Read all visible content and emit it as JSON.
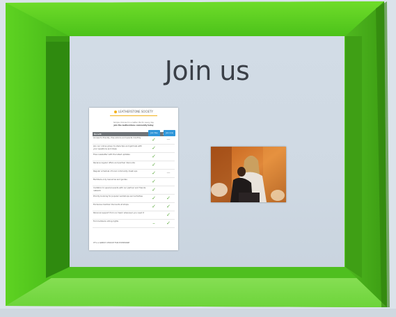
{
  "slide": {
    "title": "Join us"
  },
  "document": {
    "brand": "LEATHERSTONE SOCIETY",
    "intro_line": "Simple choices for a better life for every day",
    "intro_bold": "Join the leatherstone community today",
    "columns": [
      "Benefit",
      "Free",
      "Member"
    ],
    "rows": [
      {
        "text": "Access to friendly, free advice and events monthly",
        "free": "✓",
        "member": "—"
      },
      {
        "text": "Join our online group to share tips and get help with your questions and ideas",
        "free": "✓",
        "member": ""
      },
      {
        "text": "Free newsletter with the latest updates",
        "free": "✓",
        "member": ""
      },
      {
        "text": "Receive regular offers and partner discounts",
        "free": "✓",
        "member": ""
      },
      {
        "text": "Regular schedule of local community meet ups",
        "free": "✓",
        "member": "—"
      },
      {
        "text": "Members-only resources and guides",
        "free": "✓",
        "member": ""
      },
      {
        "text": "Invitation to special events with our partner and friends network",
        "free": "✓",
        "member": ""
      },
      {
        "text": "Priority booking for popular workshops and activities",
        "free": "✓",
        "member": "✓"
      },
      {
        "text": "Exclusive member discounts at shops",
        "free": "✓",
        "member": "✓"
      },
      {
        "text": "Personal support from our team whenever you need it",
        "free": "",
        "member": "✓"
      },
      {
        "text": "Full members voting rights",
        "free": "–",
        "member": "✓"
      }
    ],
    "footer": "IT'S A GREAT CHOICE FOR EVERYONE",
    "buttons": [
      "Join free",
      "Join now"
    ]
  },
  "colors": {
    "frame_green": "#4fbf1f",
    "frame_light_green": "#8ee05a",
    "accent_blue": "#2f96d9",
    "check_green": "#5aa83c"
  }
}
